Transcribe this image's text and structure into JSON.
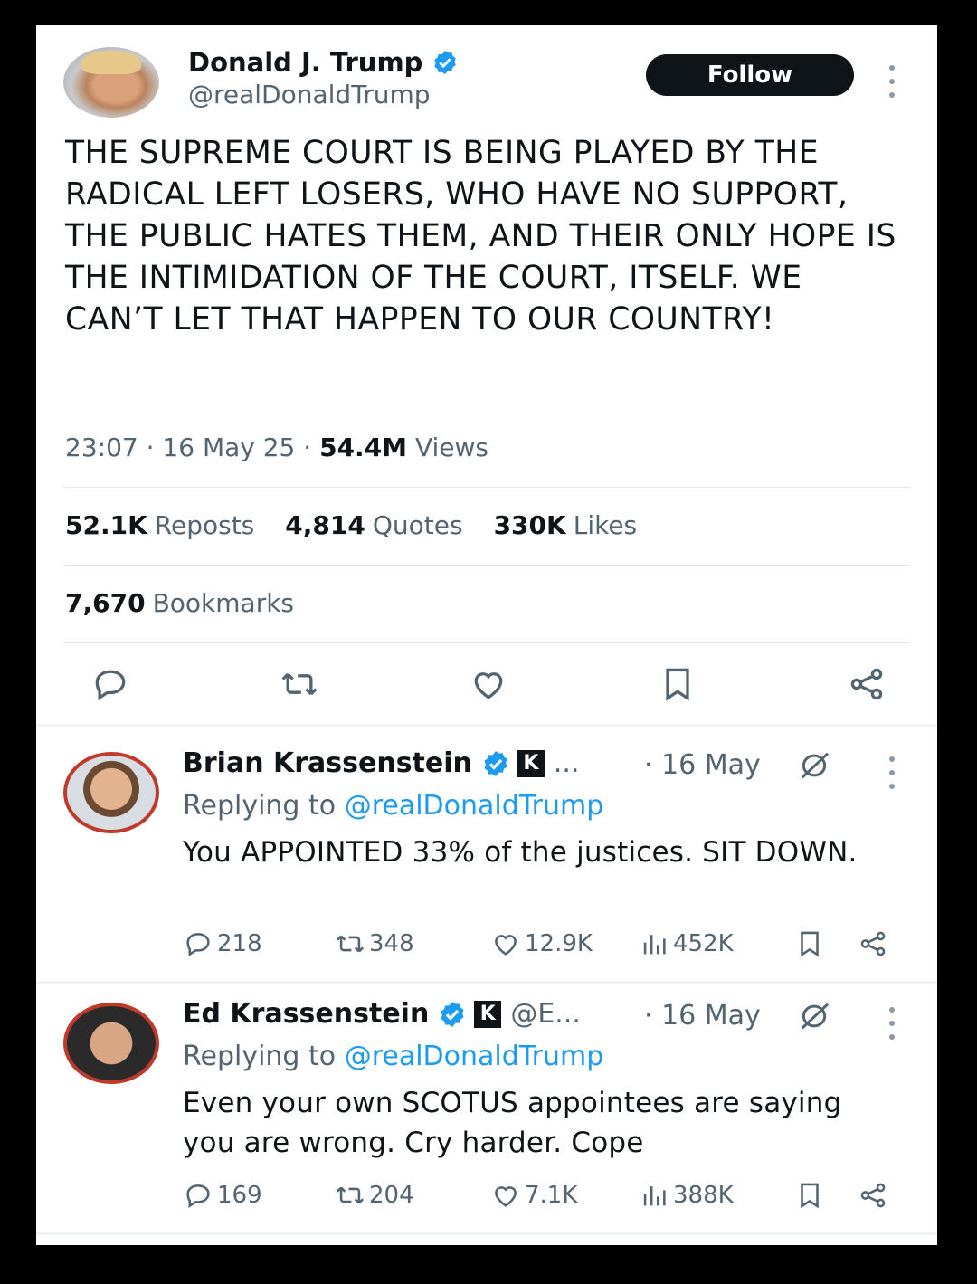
{
  "main_tweet": {
    "author_name": "Donald J. Trump",
    "handle": "@realDonaldTrump",
    "follow_label": "Follow",
    "text": "THE SUPREME COURT IS BEING PLAYED BY THE RADICAL LEFT LOSERS, WHO HAVE NO SUPPORT, THE PUBLIC HATES THEM, AND THEIR ONLY HOPE IS THE INTIMIDATION OF THE COURT, ITSELF. WE CAN’T LET THAT HAPPEN TO OUR COUNTRY!",
    "time": "23:07",
    "date": "16 May 25",
    "views_count": "54.4M",
    "views_label": "Views",
    "reposts_count": "52.1K",
    "reposts_label": "Reposts",
    "quotes_count": "4,814",
    "quotes_label": "Quotes",
    "likes_count": "330K",
    "likes_label": "Likes",
    "bookmarks_count": "7,670",
    "bookmarks_label": "Bookmarks"
  },
  "replies": [
    {
      "author_name": "Brian Krassenstein",
      "handle": "...",
      "date": "· 16 May",
      "replying_prefix": "Replying to",
      "replying_handle": "@realDonaldTrump",
      "text": "You APPOINTED 33% of the justices.  SIT DOWN.",
      "replies": "218",
      "reposts": "348",
      "likes": "12.9K",
      "views": "452K"
    },
    {
      "author_name": "Ed Krassenstein",
      "handle": "@E...",
      "date": "· 16 May",
      "replying_prefix": "Replying to",
      "replying_handle": "@realDonaldTrump",
      "text": "Even your own SCOTUS appointees are saying you are wrong.  Cry harder.  Cope",
      "replies": "169",
      "reposts": "204",
      "likes": "7.1K",
      "views": "388K"
    }
  ],
  "colors": {
    "link_blue": "#1d9bf0",
    "secondary_text": "#536471",
    "verified_blue": "#1d9bf0"
  },
  "badge_glyph": "K",
  "icons": [
    "reply-icon",
    "repost-icon",
    "like-icon",
    "bookmark-icon",
    "share-icon",
    "views-icon",
    "verified-icon",
    "grok-icon",
    "more-icon"
  ]
}
